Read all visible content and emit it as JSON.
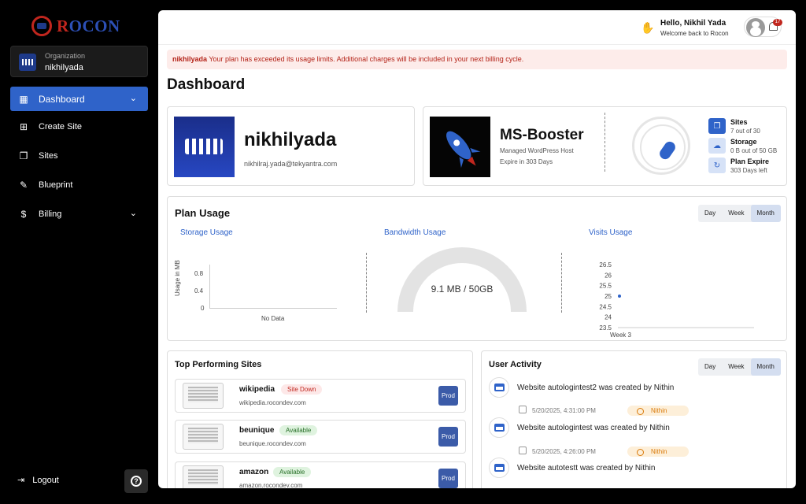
{
  "brand": {
    "name_prefix": "R",
    "name_rest": "OCON"
  },
  "org": {
    "label": "Organization",
    "name": "nikhilyada"
  },
  "nav": [
    {
      "label": "Dashboard",
      "icon": "dashboard-icon",
      "active": true
    },
    {
      "label": "Create Site",
      "icon": "create-site-icon"
    },
    {
      "label": "Sites",
      "icon": "sites-icon"
    },
    {
      "label": "Blueprint",
      "icon": "blueprint-icon"
    },
    {
      "label": "Billing",
      "icon": "billing-icon"
    }
  ],
  "logout": "Logout",
  "header": {
    "greeting": "Hello, Nikhil Yada",
    "welcome": "Welcome back to Rocon",
    "notifications": "17"
  },
  "alert": {
    "who": "nikhilyada",
    "message": " Your plan has exceeded its usage limits. Additional charges will be included in your next billing cycle."
  },
  "page_title": "Dashboard",
  "org_card": {
    "name": "nikhilyada",
    "email": "nikhilraj.yada@tekyantra.com"
  },
  "plan_card": {
    "name": "MS-Booster",
    "type": "Managed WordPress Host",
    "expire": "Expire in 303 Days",
    "stats": [
      {
        "title": "Sites",
        "sub": "7 out of 30"
      },
      {
        "title": "Storage",
        "sub": "0 B out of 50 GB"
      },
      {
        "title": "Plan Expire",
        "sub": "303 Days left"
      }
    ]
  },
  "plan_usage": {
    "title": "Plan Usage",
    "range": [
      "Day",
      "Week",
      "Month"
    ],
    "selected": "Month",
    "storage": {
      "label": "Storage Usage",
      "ylabel": "Usage in MB",
      "ticks": [
        "0.8",
        "0.4",
        "0"
      ],
      "empty": "No Data"
    },
    "bandwidth": {
      "label": "Bandwidth Usage",
      "value": "9.1 MB / 50GB",
      "fraction": 0.0002
    },
    "visits": {
      "label": "Visits Usage",
      "ticks": [
        "26.5",
        "26",
        "25.5",
        "25",
        "24.5",
        "24",
        "23.5"
      ],
      "x": "Week 3"
    }
  },
  "chart_data": {
    "type": "scatter",
    "title": "Visits Usage",
    "categories": [
      "Week 3"
    ],
    "values": [
      25
    ],
    "ylim": [
      23.5,
      26.5
    ]
  },
  "top_sites": {
    "title": "Top Performing Sites",
    "rows": [
      {
        "name": "wikipedia",
        "status": "Site Down",
        "url": "wikipedia.rocondev.com",
        "env": "Prod"
      },
      {
        "name": "beunique",
        "status": "Available",
        "url": "beunique.rocondev.com",
        "env": "Prod"
      },
      {
        "name": "amazon",
        "status": "Available",
        "url": "amazon.rocondev.com",
        "env": "Prod"
      }
    ]
  },
  "activity": {
    "title": "User Activity",
    "range": [
      "Day",
      "Week",
      "Month"
    ],
    "selected": "Month",
    "items": [
      {
        "text": "Website autologintest2 was created by Nithin",
        "time": "5/20/2025, 4:31:00 PM",
        "user": "Nithin"
      },
      {
        "text": "Website autologintest was created by Nithin",
        "time": "5/20/2025, 4:26:00 PM",
        "user": "Nithin"
      },
      {
        "text": "Website autotestt was created by Nithin",
        "time": "",
        "user": ""
      }
    ]
  }
}
